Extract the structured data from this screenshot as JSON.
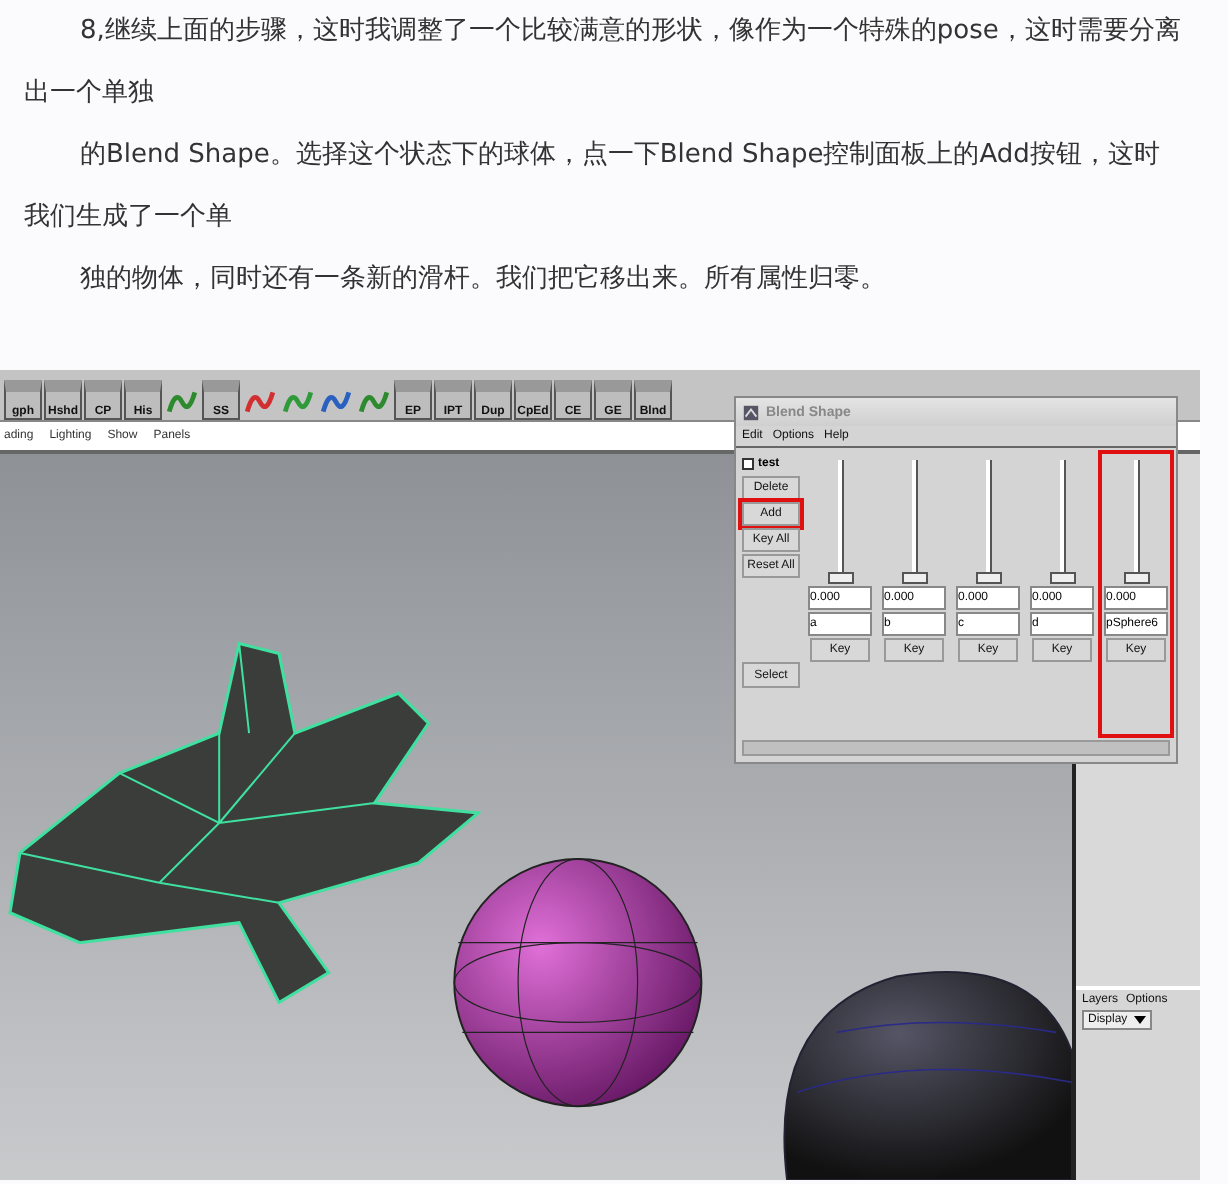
{
  "article": {
    "paragraphs": [
      "8,继续上面的步骤，这时我调整了一个比较满意的形状，像作为一个特殊的pose，这时需要分离出一个单独",
      "的Blend Shape。选择这个状态下的球体，点一下Blend Shape控制面板上的Add按钮，这时我们生成了一个单",
      "独的物体，同时还有一条新的滑杆。我们把它移出来。所有属性归零。"
    ]
  },
  "screenshot": {
    "shelf": [
      {
        "kind": "labeled",
        "label": "gph"
      },
      {
        "kind": "labeled",
        "label": "Hshd"
      },
      {
        "kind": "labeled",
        "label": "CP"
      },
      {
        "kind": "labeled",
        "label": "His"
      },
      {
        "kind": "icon"
      },
      {
        "kind": "labeled",
        "label": "SS"
      },
      {
        "kind": "icon"
      },
      {
        "kind": "icon"
      },
      {
        "kind": "icon"
      },
      {
        "kind": "icon"
      },
      {
        "kind": "labeled",
        "label": "EP"
      },
      {
        "kind": "labeled",
        "label": "IPT"
      },
      {
        "kind": "labeled",
        "label": "Dup"
      },
      {
        "kind": "labeled",
        "label": "CpEd"
      },
      {
        "kind": "labeled",
        "label": "CE"
      },
      {
        "kind": "labeled",
        "label": "GE"
      },
      {
        "kind": "labeled",
        "label": "Blnd"
      }
    ],
    "panel_menu": [
      "ading",
      "Lighting",
      "Show",
      "Panels"
    ],
    "blend_shape": {
      "title": "Blend Shape",
      "menu": [
        "Edit",
        "Options",
        "Help"
      ],
      "node": "test",
      "buttons": [
        {
          "label": "Delete",
          "highlighted": false
        },
        {
          "label": "Add",
          "highlighted": true
        },
        {
          "label": "Key All",
          "highlighted": false
        },
        {
          "label": "Reset All",
          "highlighted": false
        }
      ],
      "select_button": "Select",
      "sliders": [
        {
          "level": 0,
          "value": "0.000",
          "name": "a",
          "key": "Key",
          "highlighted": false
        },
        {
          "level": 0,
          "value": "0.000",
          "name": "b",
          "key": "Key",
          "highlighted": false
        },
        {
          "level": 0,
          "value": "0.000",
          "name": "c",
          "key": "Key",
          "highlighted": false
        },
        {
          "level": 0,
          "value": "0.000",
          "name": "d",
          "key": "Key",
          "highlighted": false
        },
        {
          "level": 0,
          "value": "0.000",
          "name": "pSphere6",
          "key": "Key",
          "highlighted": true
        }
      ]
    },
    "layers": {
      "menu": [
        "Layers",
        "Options"
      ],
      "dropdown": "Display"
    }
  }
}
